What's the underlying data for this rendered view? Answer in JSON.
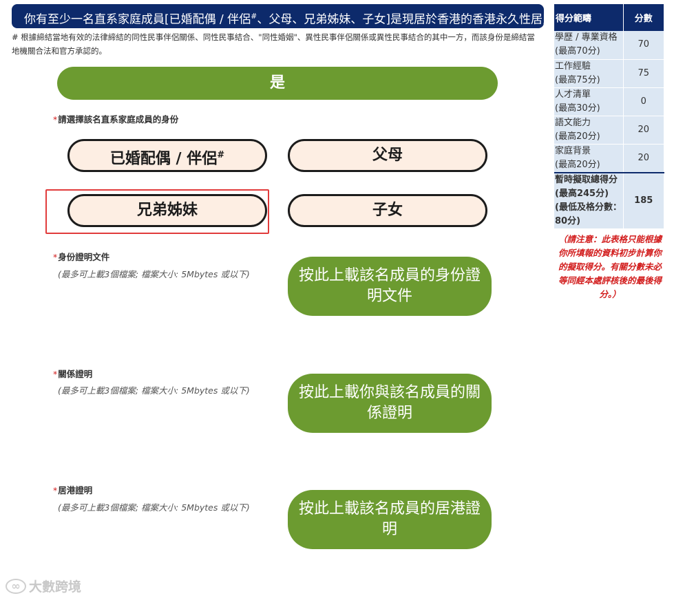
{
  "question": {
    "text_before": "你有至少一名直系家庭成員[已婚配偶 / 伴侶",
    "mark": "#",
    "text_after": "、父母、兄弟姊妹、子女]是現居於香港的香港永久性居民?"
  },
  "footnote": "# 根據締結當地有效的法律締結的同性民事伴侶關係、同性民事結合、\"同性婚姻\"、異性民事伴侶關係或異性民事結合的其中一方，而該身份是締結當地機關合法和官方承認的。",
  "yes_label": "是",
  "relation": {
    "required_mark": "*",
    "label": "請選擇該名直系家庭成員的身份",
    "options": {
      "spouse": "已婚配偶 / 伴侶",
      "spouse_mark": "#",
      "parents": "父母",
      "siblings": "兄弟姊妹",
      "children": "子女"
    },
    "selected": "兄弟姊妹"
  },
  "uploads": [
    {
      "required_mark": "*",
      "label": "身份證明文件",
      "hint": "(最多可上載3個檔案; 檔案大小: 5Mbytes 或以下)",
      "button": "按此上載該名成員的身份證明文件"
    },
    {
      "required_mark": "*",
      "label": "關係證明",
      "hint": "(最多可上載3個檔案; 檔案大小: 5Mbytes 或以下)",
      "button": "按此上載你與該名成員的關係證明"
    },
    {
      "required_mark": "*",
      "label": "居港證明",
      "hint": "(最多可上載3個檔案; 檔案大小: 5Mbytes 或以下)",
      "button": "按此上載該名成員的居港證明"
    }
  ],
  "score_table": {
    "headers": [
      "得分範疇",
      "分數"
    ],
    "rows": [
      {
        "name": "學歷 / 專業資格",
        "max": "(最高70分)",
        "score": "70"
      },
      {
        "name": "工作經驗",
        "max": "(最高75分)",
        "score": "75"
      },
      {
        "name": "人才清單",
        "max": "(最高30分)",
        "score": "0"
      },
      {
        "name": "語文能力",
        "max": "(最高20分)",
        "score": "20"
      },
      {
        "name": "家庭背景",
        "max": "(最高20分)",
        "score": "20"
      }
    ],
    "total": {
      "name": "暫時擬取總得分",
      "max": "(最高245分)",
      "min_pass": "(最低及格分數：80分)",
      "score": "185"
    },
    "note": "（請注意：此表格只能根據你所填報的資料初步計算你的擬取得分。有關分數未必等同經本處評核後的最後得分。）"
  },
  "watermark": "大數跨境",
  "colors": {
    "navy": "#0d2a6b",
    "green": "#6c9b30",
    "choice_bg": "#fdeee3",
    "required_red": "#d21d1d",
    "highlight_red": "#e13b3b",
    "table_bg": "#dce7f3"
  }
}
